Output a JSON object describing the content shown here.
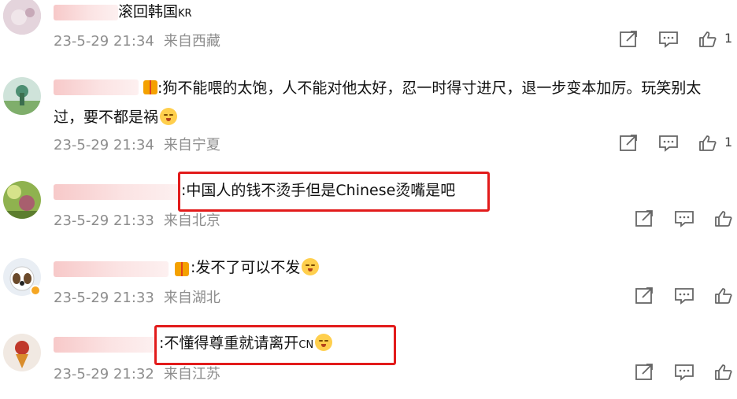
{
  "comments": [
    {
      "text": "滚回韩国",
      "tag": "KR",
      "date": "23-5-29 21:34",
      "location": "来自西藏",
      "likes": "1"
    },
    {
      "text": ":狗不能喂的太饱，人不能对他太好，忍一时得寸进尺，退一步变本加厉。玩笑别太过，要不都是祸",
      "date": "23-5-29 21:34",
      "location": "来自宁夏",
      "likes": "1"
    },
    {
      "text": ":中国人的钱不烫手但是Chinese烫嘴是吧",
      "date": "23-5-29 21:33",
      "location": "来自北京",
      "likes": ""
    },
    {
      "text": ":发不了可以不发",
      "date": "23-5-29 21:33",
      "location": "来自湖北",
      "likes": ""
    },
    {
      "text": ":不懂得尊重就请离开",
      "tag": "CN",
      "date": "23-5-29 21:32",
      "location": "来自江苏",
      "likes": ""
    }
  ],
  "colors": {
    "highlight": "#e21b1b",
    "meta": "#8d8d8d",
    "badge": "#f5a623"
  },
  "icons": [
    "share-icon",
    "comment-icon",
    "like-icon",
    "emoji-icon"
  ]
}
